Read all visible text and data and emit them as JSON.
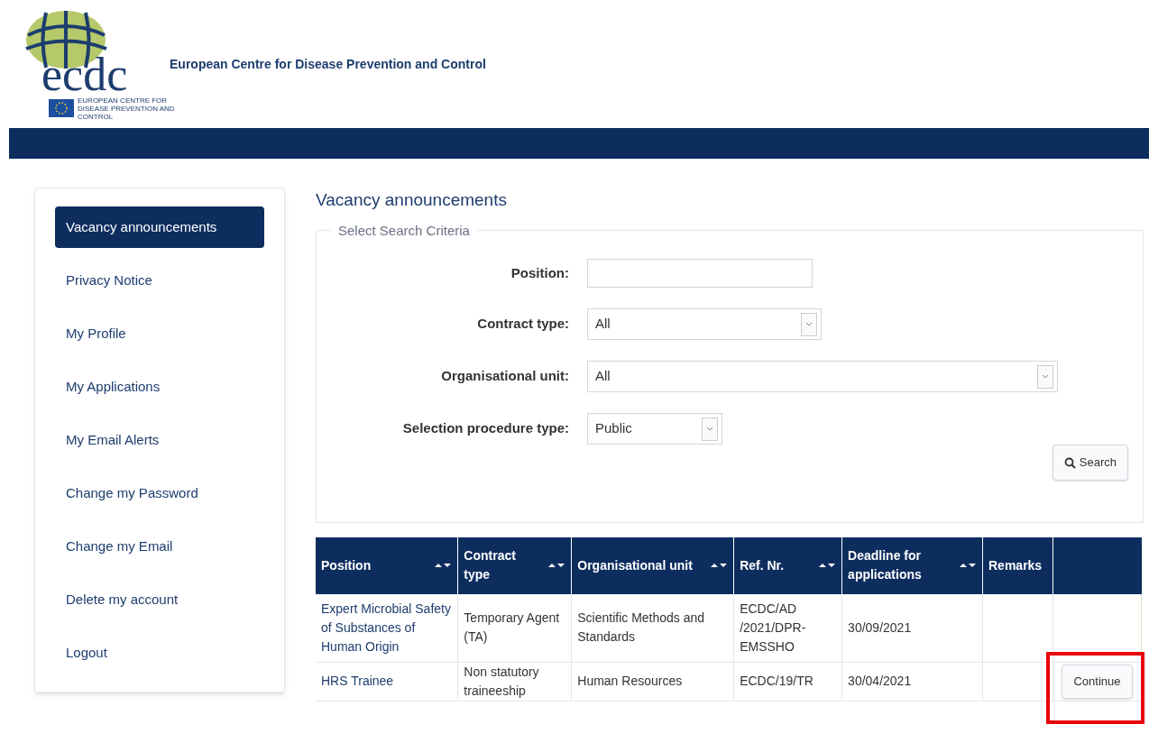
{
  "header": {
    "logo_text": "ecdc",
    "logo_caption": "EUROPEAN CENTRE FOR DISEASE PREVENTION AND CONTROL",
    "title": "European Centre for Disease Prevention and Control"
  },
  "sidebar": {
    "items": [
      {
        "label": "Vacancy announcements",
        "selected": true
      },
      {
        "label": "Privacy Notice",
        "selected": false
      },
      {
        "label": "My Profile",
        "selected": false
      },
      {
        "label": "My Applications",
        "selected": false
      },
      {
        "label": "My Email Alerts",
        "selected": false
      },
      {
        "label": "Change my Password",
        "selected": false
      },
      {
        "label": "Change my Email",
        "selected": false
      },
      {
        "label": "Delete my account",
        "selected": false
      },
      {
        "label": "Logout",
        "selected": false
      }
    ]
  },
  "page_title": "Vacancy announcements",
  "search_form": {
    "legend": "Select Search Criteria",
    "fields": [
      {
        "kind": "text",
        "label": "Position:"
      },
      {
        "kind": "select",
        "label": "Contract type:",
        "value": "All"
      },
      {
        "kind": "select",
        "label": "Organisational unit:",
        "value": "All"
      },
      {
        "kind": "select",
        "label": "Selection procedure type:",
        "value": "Public"
      }
    ],
    "search_button": "Search"
  },
  "table": {
    "columns": [
      {
        "label": "Position",
        "sortable": true
      },
      {
        "label": "Contract type",
        "sortable": true
      },
      {
        "label": "Organisational unit",
        "sortable": true
      },
      {
        "label": "Ref. Nr.",
        "sortable": true
      },
      {
        "label": "Deadline for applications",
        "sortable": true
      },
      {
        "label": "Remarks",
        "sortable": false
      }
    ],
    "rows": [
      {
        "position": "Expert Microbial Safety of Substances of Human Origin",
        "contract_type": "Temporary Agent (TA)",
        "unit": "Scientific Methods and Standards",
        "ref": "ECDC/AD /2021/DPR-EMSSHO",
        "deadline": "30/09/2021",
        "highlighted": false
      },
      {
        "position": "HRS Trainee",
        "contract_type": "Non statutory traineeship",
        "unit": "Human Resources",
        "ref": "ECDC/19/TR",
        "deadline": "30/04/2021",
        "action": "Continue",
        "highlighted": true
      }
    ]
  }
}
